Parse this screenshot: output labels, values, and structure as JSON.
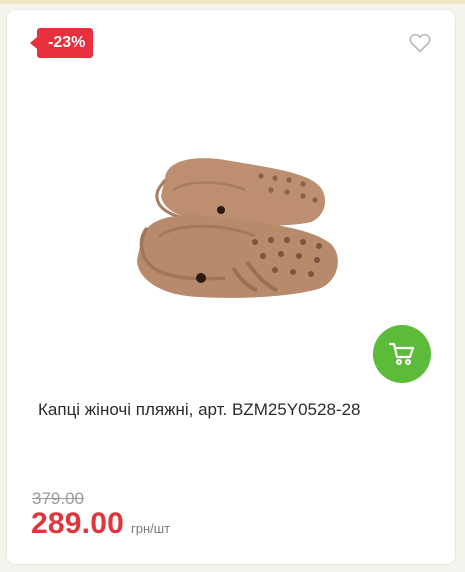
{
  "product": {
    "discount_badge": "-23%",
    "title": "Капці жіночі пляжні, арт. BZM25Y0528-28",
    "old_price": "379.00",
    "price": "289.00",
    "unit": "грн/шт",
    "image": "beige-clogs-pair"
  },
  "icons": {
    "favorite": "heart-outline-icon",
    "cart": "shopping-cart-icon"
  },
  "colors": {
    "badge": "#e8303e",
    "price": "#e0353c",
    "cart_button": "#5cbc3a",
    "clog": "#b88a6c"
  }
}
